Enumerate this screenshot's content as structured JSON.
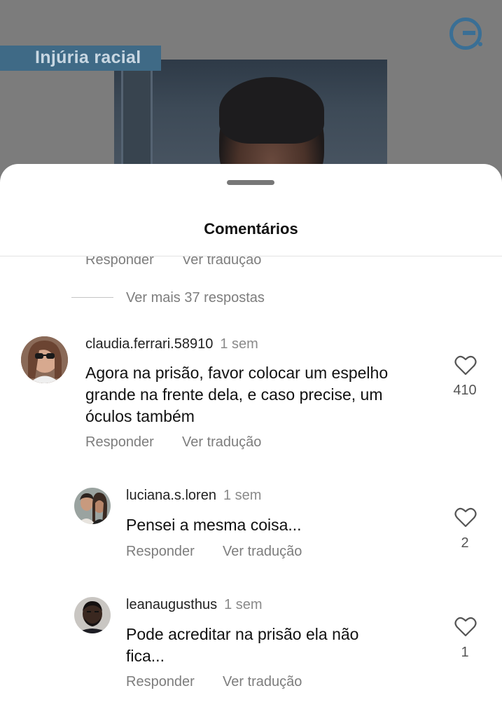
{
  "post": {
    "tag": "Injúria racial"
  },
  "sheet": {
    "title": "Comentários"
  },
  "actions": {
    "reply": "Responder",
    "translate": "Ver tradução",
    "translate_cut": "Ver tradução"
  },
  "more_replies": "Ver mais 37 respostas",
  "comments": [
    {
      "user": "claudia.ferrari.58910",
      "time": "1 sem",
      "lines": [
        "Agora na prisão,  favor colocar um espelho",
        "grande na frente dela,  e caso precise,  um",
        "óculos também"
      ],
      "likes": "410"
    },
    {
      "user": "luciana.s.loren",
      "time": "1 sem",
      "lines": [
        "Pensei a mesma coisa..."
      ],
      "likes": "2"
    },
    {
      "user": "leanaugusthus",
      "time": "1 sem",
      "lines": [
        "Pode acreditar na prisão ela não",
        "fica..."
      ],
      "likes": "1"
    }
  ],
  "colors": {
    "tag_bg": "#3f6a86",
    "logo": "#3a6f95",
    "muted_text": "#7d7d7d"
  },
  "icons": {
    "like": "heart-outline-icon",
    "logo": "g-logo-icon"
  }
}
